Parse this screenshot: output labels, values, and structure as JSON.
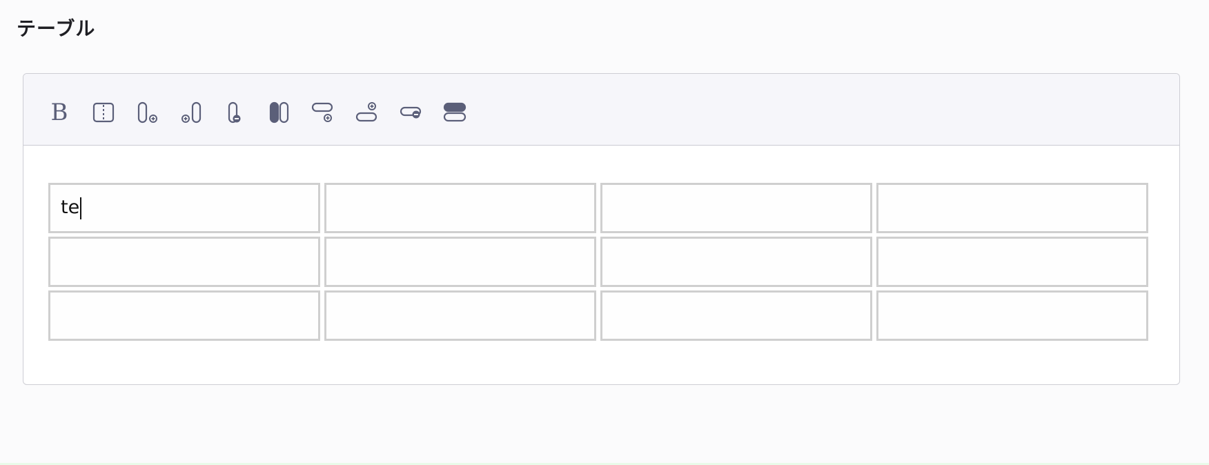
{
  "section": {
    "title": "テーブル"
  },
  "toolbar": {
    "tools": [
      {
        "icon": "bold-icon",
        "glyph": "B"
      },
      {
        "icon": "split-cell-icon"
      },
      {
        "icon": "add-column-after-icon"
      },
      {
        "icon": "add-column-before-icon"
      },
      {
        "icon": "delete-column-icon"
      },
      {
        "icon": "merge-columns-icon"
      },
      {
        "icon": "add-row-after-icon"
      },
      {
        "icon": "add-row-before-icon"
      },
      {
        "icon": "delete-row-icon"
      },
      {
        "icon": "merge-rows-icon"
      }
    ],
    "icon_color": "#5b5f79"
  },
  "table": {
    "rows": [
      [
        "te",
        "",
        "",
        ""
      ],
      [
        "",
        "",
        "",
        ""
      ],
      [
        "",
        "",
        "",
        ""
      ]
    ]
  }
}
